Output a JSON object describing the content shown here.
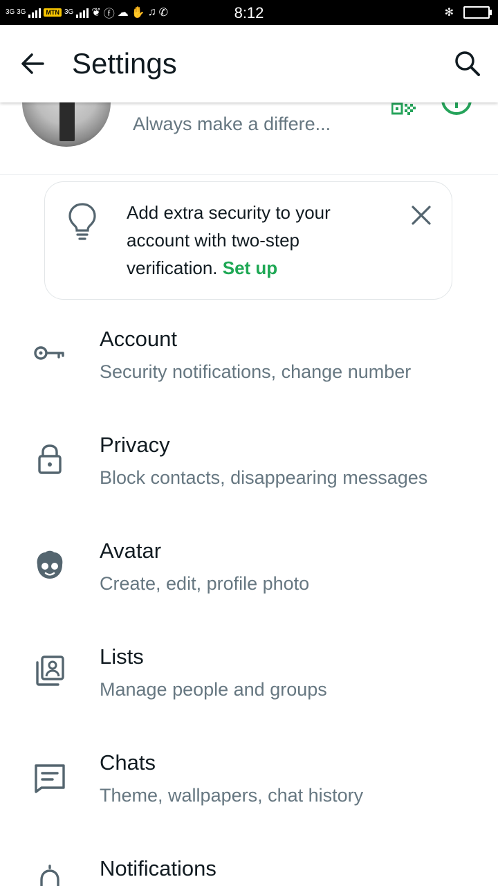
{
  "status_bar": {
    "network_left": "3G 3G",
    "operator": "MTN",
    "network_right": "3G",
    "time": "8:12"
  },
  "app_bar": {
    "title": "Settings"
  },
  "profile": {
    "about": "Always make a differe..."
  },
  "security_card": {
    "text": "Add extra security to your account with two-step verification.",
    "link": "Set up"
  },
  "settings": [
    {
      "title": "Account",
      "subtitle": "Security notifications, change number",
      "icon": "key-icon"
    },
    {
      "title": "Privacy",
      "subtitle": "Block contacts, disappearing messages",
      "icon": "lock-icon"
    },
    {
      "title": "Avatar",
      "subtitle": "Create, edit, profile photo",
      "icon": "avatar-face-icon"
    },
    {
      "title": "Lists",
      "subtitle": "Manage people and groups",
      "icon": "contact-list-icon"
    },
    {
      "title": "Chats",
      "subtitle": "Theme, wallpapers, chat history",
      "icon": "chat-icon"
    },
    {
      "title": "Notifications",
      "subtitle": "",
      "icon": "bell-icon"
    }
  ],
  "colors": {
    "accent": "#1fa855",
    "text_primary": "#111b21",
    "text_secondary": "#667781",
    "icon_gray": "#54656f"
  }
}
